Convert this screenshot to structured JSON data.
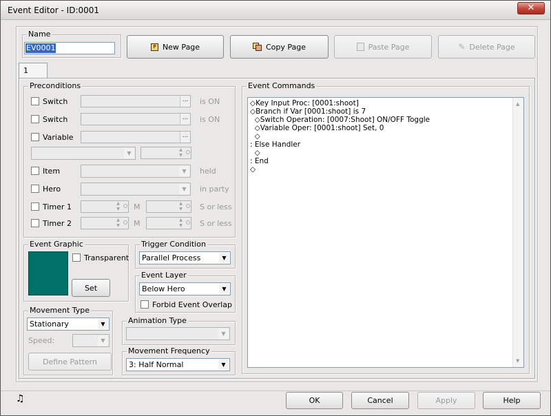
{
  "window": {
    "title": "Event Editor - ID:0001",
    "close_glyph": "✕"
  },
  "name_section": {
    "label": "Name",
    "value": "EV0001"
  },
  "page_buttons": {
    "new_page": "New Page",
    "copy_page": "Copy Page",
    "paste_page": "Paste Page",
    "delete_page": "Delete Page"
  },
  "tabs": [
    {
      "label": "1"
    }
  ],
  "preconditions": {
    "label": "Preconditions",
    "switch1": {
      "label": "Switch",
      "suffix": "is ON"
    },
    "switch2": {
      "label": "Switch",
      "suffix": "is ON"
    },
    "variable": {
      "label": "Variable"
    },
    "item": {
      "label": "Item",
      "suffix": "held"
    },
    "hero": {
      "label": "Hero",
      "suffix": "in party"
    },
    "timer1": {
      "label": "Timer 1",
      "min_unit": "M",
      "sec_unit": "S or less"
    },
    "timer2": {
      "label": "Timer 2",
      "min_unit": "M",
      "sec_unit": "S or less"
    },
    "ellipsis": "..."
  },
  "event_graphic": {
    "label": "Event Graphic",
    "transparent_label": "Transparent",
    "set_label": "Set",
    "color": "#007168"
  },
  "trigger": {
    "label": "Trigger Condition",
    "value": "Parallel Process"
  },
  "event_layer": {
    "label": "Event Layer",
    "value": "Below Hero",
    "forbid_label": "Forbid Event Overlap"
  },
  "movement_type": {
    "label": "Movement Type",
    "value": "Stationary",
    "speed_label": "Speed:",
    "define_pattern": "Define Pattern"
  },
  "animation_type": {
    "label": "Animation Type",
    "value": ""
  },
  "movement_frequency": {
    "label": "Movement Frequency",
    "value": "3: Half Normal"
  },
  "event_commands": {
    "label": "Event Commands",
    "lines": [
      "◇Key Input Proc: [0001:shoot]",
      "◇Branch if Var [0001:shoot] is 7",
      "  ◇Switch Operation: [0007:Shoot] ON/OFF Toggle",
      "  ◇Variable Oper: [0001:shoot] Set, 0",
      "  ◇",
      ": Else Handler",
      "  ◇",
      ": End",
      "◇"
    ]
  },
  "footer": {
    "ok": "OK",
    "cancel": "Cancel",
    "apply": "Apply",
    "help": "Help",
    "music_glyph": "♫"
  }
}
